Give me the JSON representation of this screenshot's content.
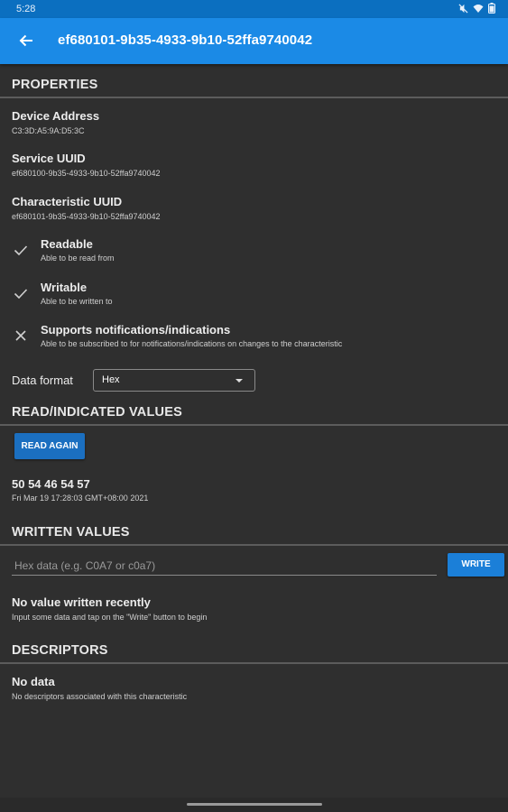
{
  "status_bar": {
    "time": "5:28",
    "icons": [
      "mute-icon",
      "wifi-icon",
      "battery-icon"
    ]
  },
  "app_bar": {
    "back_icon": "arrow-left-icon",
    "title": "ef680101-9b35-4933-9b10-52ffa9740042"
  },
  "properties": {
    "header": "PROPERTIES",
    "device_address": {
      "label": "Device Address",
      "value": "C3:3D:A5:9A:D5:3C"
    },
    "service_uuid": {
      "label": "Service UUID",
      "value": "ef680100-9b35-4933-9b10-52ffa9740042"
    },
    "characteristic_uuid": {
      "label": "Characteristic UUID",
      "value": "ef680101-9b35-4933-9b10-52ffa9740042"
    },
    "capabilities": [
      {
        "label": "Readable",
        "description": "Able to be read from",
        "icon": "check-icon"
      },
      {
        "label": "Writable",
        "description": "Able to be written to",
        "icon": "check-icon"
      },
      {
        "label": "Supports notifications/indications",
        "description": "Able to be subscribed to for notifications/indications on changes to the characteristic",
        "icon": "close-icon"
      }
    ],
    "data_format": {
      "label": "Data format",
      "selected": "Hex"
    }
  },
  "read_values": {
    "header": "READ/INDICATED VALUES",
    "button_label": "READ AGAIN",
    "value": "50 54 46 54 57",
    "timestamp": "Fri Mar 19 17:28:03 GMT+08:00 2021"
  },
  "written_values": {
    "header": "WRITTEN VALUES",
    "input_placeholder": "Hex data (e.g. C0A7 or c0a7)",
    "input_value": "",
    "button_label": "WRITE",
    "empty_title": "No value written recently",
    "empty_description": "Input some data and tap on the \"Write\" button to begin"
  },
  "descriptors": {
    "header": "DESCRIPTORS",
    "empty_title": "No data",
    "empty_description": "No descriptors associated with this characteristic"
  },
  "colors": {
    "app_bar": "#1b8ae6",
    "status_bar": "#0b6fc0",
    "background": "#2f2f2f",
    "button": "#1b6fc0"
  }
}
